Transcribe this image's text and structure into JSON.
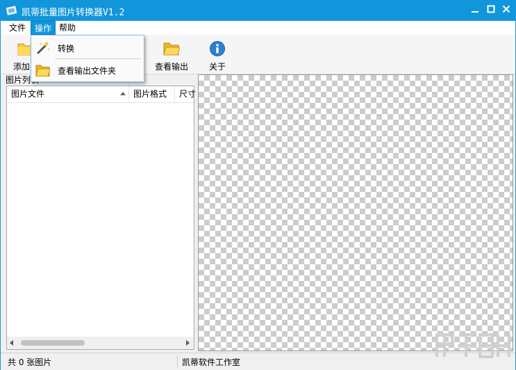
{
  "window": {
    "title": "凯蒂批量图片转换器V1.2"
  },
  "menu": {
    "file": "文件",
    "operation": "操作",
    "help": "帮助"
  },
  "dropdown": {
    "convert": "转换",
    "view_output_folder": "查看输出文件夹"
  },
  "toolbar": {
    "add_label": "添加图",
    "view_output_label": "查看输出",
    "about_label": "关于"
  },
  "list_panel": {
    "caption": "图片列表",
    "columns": [
      "图片文件",
      "图片格式",
      "尺寸"
    ]
  },
  "statusbar": {
    "count": "共 0 张图片",
    "studio": "凯蒂软件工作室"
  },
  "colors": {
    "accent": "#1296db",
    "title_text": "#ffffff",
    "checker": "#cccccc"
  },
  "icons": [
    "app-icon",
    "minimize-icon",
    "maximize-icon",
    "close-icon",
    "folder-add-icon",
    "folder-open-icon",
    "info-icon",
    "magic-wand-icon",
    "sort-ascending-icon"
  ]
}
